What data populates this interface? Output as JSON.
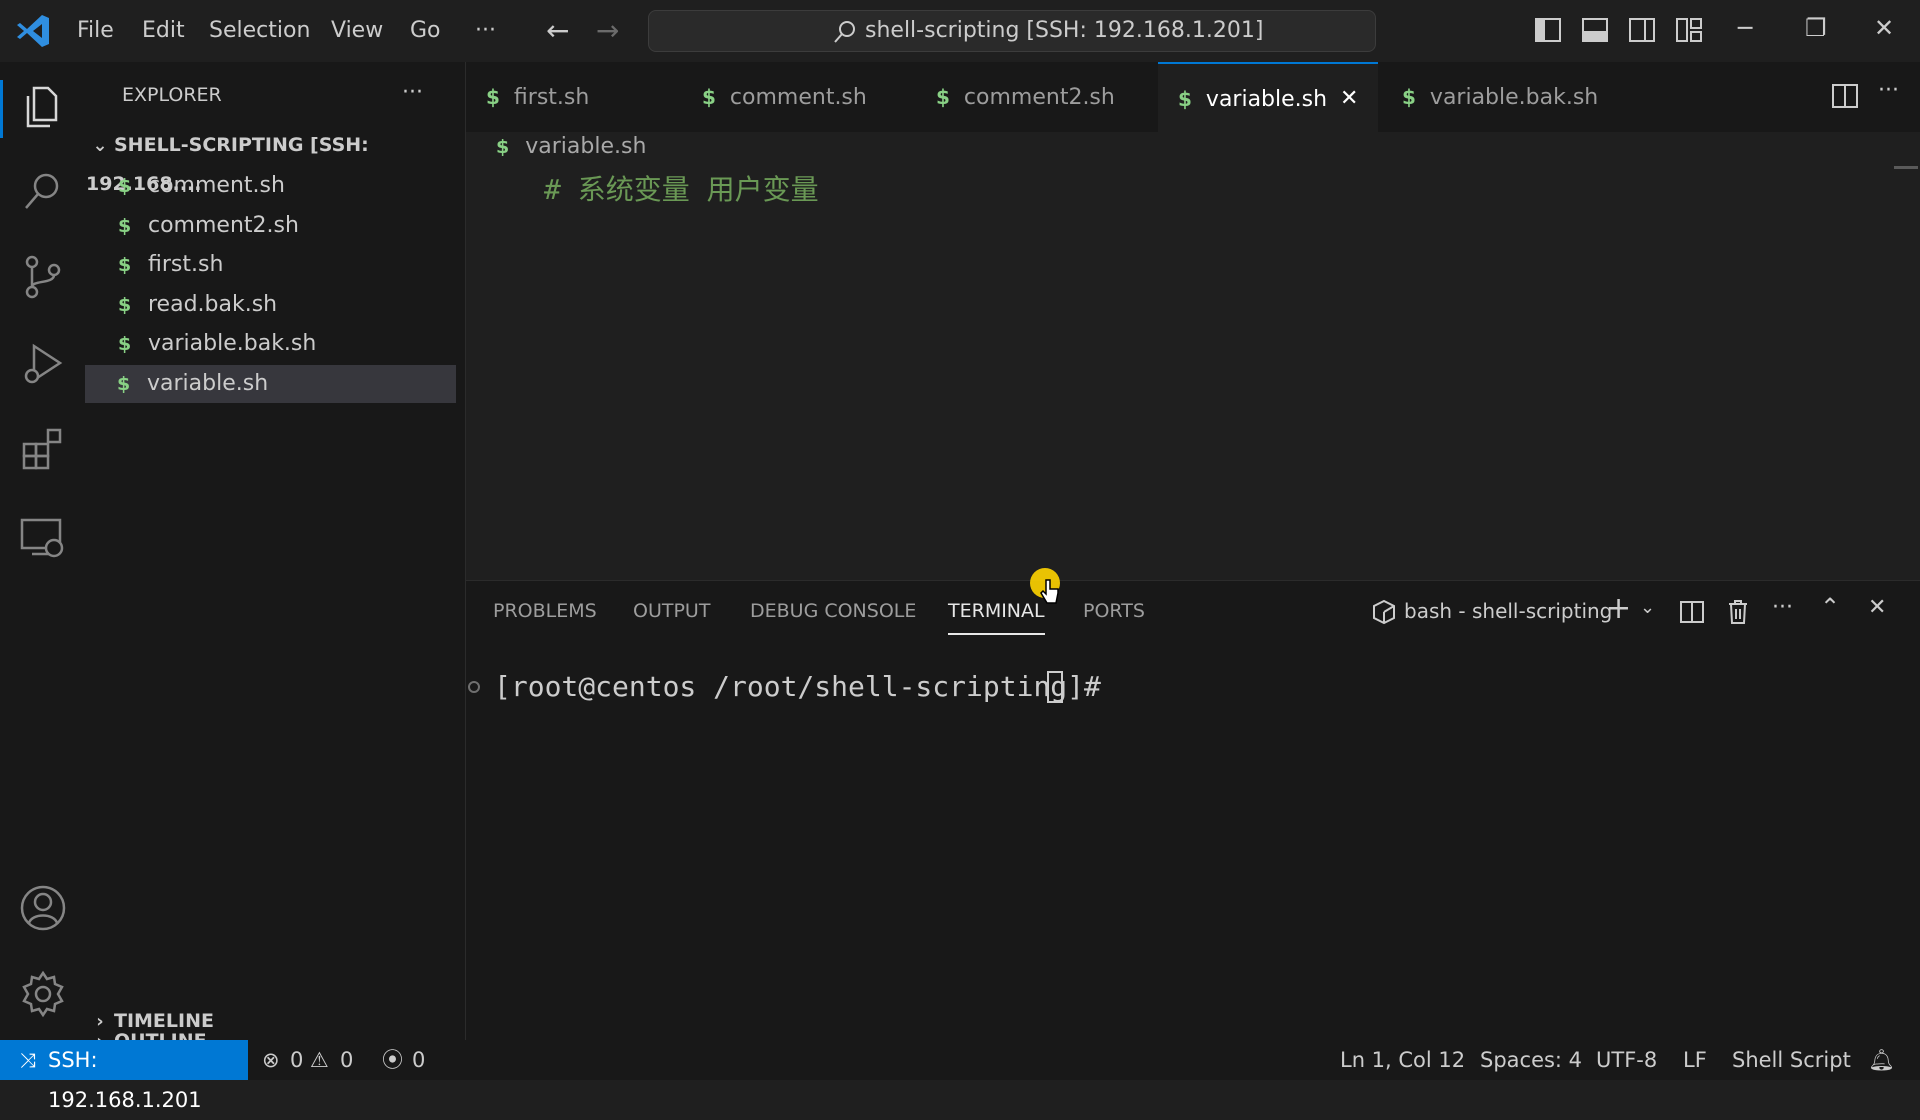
{
  "menu": [
    "File",
    "Edit",
    "Selection",
    "View",
    "Go",
    "···"
  ],
  "command_center": {
    "text": "shell-scripting [SSH: 192.168.1.201]"
  },
  "sidebar": {
    "title": "EXPLORER",
    "more": "···",
    "root_folder": "SHELL-SCRIPTING [SSH: 192.168....",
    "files": [
      {
        "name": "comment.sh"
      },
      {
        "name": "comment2.sh"
      },
      {
        "name": "first.sh"
      },
      {
        "name": "read.bak.sh"
      },
      {
        "name": "variable.bak.sh"
      },
      {
        "name": "variable.sh"
      }
    ],
    "selected_file": "variable.sh",
    "outline": "OUTLINE",
    "timeline": "TIMELINE"
  },
  "tabs": [
    {
      "label": "first.sh"
    },
    {
      "label": "comment.sh"
    },
    {
      "label": "comment2.sh"
    },
    {
      "label": "variable.sh",
      "active": true
    },
    {
      "label": "variable.bak.sh"
    }
  ],
  "file_icon_glyph": "$",
  "editor": {
    "breadcrumb": "variable.sh",
    "line1": "# 系统变量 用户变量"
  },
  "panel": {
    "tabs": [
      "PROBLEMS",
      "OUTPUT",
      "DEBUG CONSOLE",
      "TERMINAL",
      "PORTS"
    ],
    "active_tab": "TERMINAL",
    "terminal_name": "bash - shell-scripting",
    "prompt": "[root@centos /root/shell-scripting]#"
  },
  "statusbar": {
    "remote": "SSH: 192.168.1.201",
    "errors": "0",
    "warnings": "0",
    "ports": "0",
    "position": "Ln 1, Col 12",
    "spaces": "Spaces: 4",
    "encoding": "UTF-8",
    "eol": "LF",
    "language": "Shell Script"
  },
  "colors": {
    "accent": "#0078d4",
    "shell_icon": "#89d185",
    "comment": "#6a9955"
  }
}
